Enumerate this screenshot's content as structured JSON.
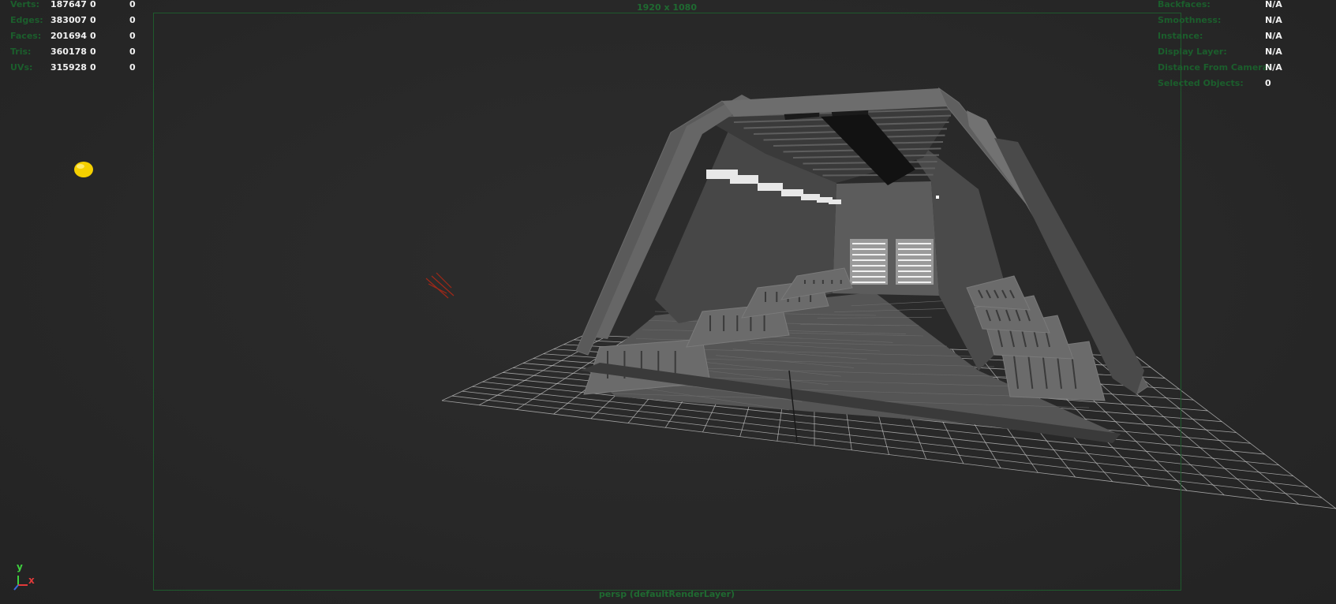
{
  "viewport": {
    "resolution_gate_label": "1920 x 1080",
    "camera_label": "persp (defaultRenderLayer)"
  },
  "poly_count_hud": {
    "rows": [
      {
        "label": "Verts:",
        "total": "187647",
        "selected": "0",
        "selected_components": "0"
      },
      {
        "label": "Edges:",
        "total": "383007",
        "selected": "0",
        "selected_components": "0"
      },
      {
        "label": "Faces:",
        "total": "201694",
        "selected": "0",
        "selected_components": "0"
      },
      {
        "label": "Tris:",
        "total": "360178",
        "selected": "0",
        "selected_components": "0"
      },
      {
        "label": "UVs:",
        "total": "315928",
        "selected": "0",
        "selected_components": "0"
      }
    ]
  },
  "object_details_hud": {
    "rows": [
      {
        "label": "Backfaces:",
        "value": "N/A"
      },
      {
        "label": "Smoothness:",
        "value": "N/A"
      },
      {
        "label": "Instance:",
        "value": "N/A"
      },
      {
        "label": "Display Layer:",
        "value": "N/A"
      },
      {
        "label": "Distance From Camera:",
        "value": "N/A"
      },
      {
        "label": "Selected Objects:",
        "value": "0"
      }
    ]
  },
  "axis_gizmo": {
    "y_label": "y",
    "x_label": "x"
  },
  "colors": {
    "hud_label": "#1b5e2c",
    "hud_value": "#f2f2f2",
    "gate_border": "#1e5a2c",
    "light_locator": "#f5d000",
    "grid_line": "#c8c8c8",
    "model_mid": "#5a5a5a",
    "axis_y": "#3fd13f",
    "axis_x": "#e23a3a",
    "axis_z": "#3a6ae2"
  },
  "scene_objects": {
    "light_icon": "point-light-locator",
    "camera_icon": "directional-light-locator",
    "model": "sci-fi-corridor-mesh",
    "grid": "ground-grid"
  }
}
